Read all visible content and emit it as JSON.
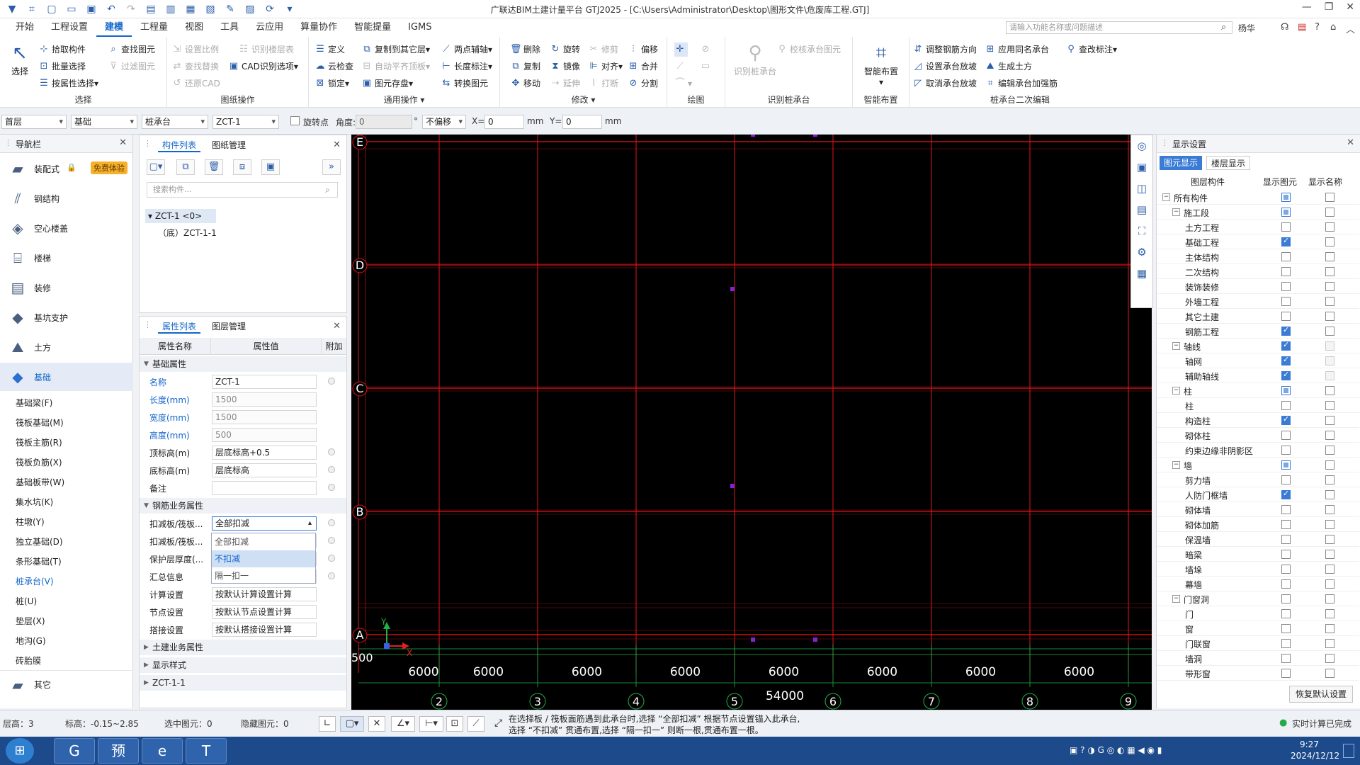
{
  "window": {
    "title": "广联达BIM土建计量平台 GTJ2025 - [C:\\Users\\Administrator\\Desktop\\图形文件\\危废库工程.GTJ]"
  },
  "menu": {
    "items": [
      "开始",
      "工程设置",
      "建模",
      "工程量",
      "视图",
      "工具",
      "云应用",
      "算量协作",
      "智能提量",
      "IGMS"
    ],
    "search_placeholder": "请输入功能名称或问题描述",
    "user": "杨华"
  },
  "ribbon": {
    "select": {
      "label": "选择",
      "pick": "拾取构件",
      "batch": "批量选择",
      "by_prop": "按属性选择",
      "find": "查找图元",
      "filter": "过滤图元"
    },
    "drawing": {
      "label": "图纸操作",
      "set_scale": "设置比例",
      "identify_layer": "识别楼层表",
      "find_replace": "查找替换",
      "cad_options": "CAD识别选项",
      "restore_cad": "还原CAD"
    },
    "general": {
      "label": "通用操作",
      "define": "定义",
      "copy_other": "复制到其它层",
      "two_point": "两点辅轴",
      "cloud_check": "云检查",
      "auto_flat": "自动平齐顶板",
      "length_mark": "长度标注",
      "lock": "锁定",
      "elem_save": "图元存盘",
      "convert": "转换图元"
    },
    "modify": {
      "label": "修改",
      "delete": "删除",
      "rotate": "旋转",
      "trim": "修剪",
      "offset": "偏移",
      "copy": "复制",
      "mirror": "镜像",
      "align": "对齐",
      "merge": "合并",
      "move": "移动",
      "extend": "延伸",
      "break": "打断",
      "split": "分割"
    },
    "draw": {
      "label": "绘图"
    },
    "identify": {
      "label": "识别桩承台",
      "identify_cap": "识别桩承台",
      "check_cap": "校核承台图元"
    },
    "smart": {
      "label": "智能布置",
      "smart_layout": "智能布置"
    },
    "secondary": {
      "label": "桩承台二次编辑",
      "adjust_rebar": "调整钢筋方向",
      "apply_same": "应用同名承台",
      "check_mark": "查改标注",
      "set_slope": "设置承台放坡",
      "gen_earth": "生成土方",
      "cancel_slope": "取消承台放坡",
      "edit_reinf": "编辑承台加强筋"
    }
  },
  "propbar": {
    "floor": "首层",
    "category": "基础",
    "type": "桩承台",
    "name": "ZCT-1",
    "rotate_label": "旋转点",
    "angle_label": "角度:",
    "angle_value": "0",
    "offset": "不偏移",
    "x_label": "X=",
    "x_value": "0",
    "y_label": "Y=",
    "y_value": "0",
    "unit": "mm",
    "deg": "°"
  },
  "nav": {
    "title": "导航栏",
    "badge": "免费体验",
    "categories": [
      "装配式",
      "钢结构",
      "空心楼盖",
      "楼梯",
      "装修",
      "基坑支护",
      "土方",
      "基础",
      "其它"
    ],
    "sub": [
      "基础梁(F)",
      "筏板基础(M)",
      "筏板主筋(R)",
      "筏板负筋(X)",
      "基础板带(W)",
      "集水坑(K)",
      "柱墩(Y)",
      "独立基础(D)",
      "条形基础(T)",
      "桩承台(V)",
      "桩(U)",
      "垫层(X)",
      "地沟(G)",
      "砖胎膜"
    ]
  },
  "complist": {
    "tab1": "构件列表",
    "tab2": "图纸管理",
    "search": "搜索构件...",
    "item": "ZCT-1 <0>",
    "child": "（底）ZCT-1-1"
  },
  "proplist": {
    "tab1": "属性列表",
    "tab2": "图层管理",
    "col1": "属性名称",
    "col2": "属性值",
    "col3": "附加",
    "sec1": "基础属性",
    "rows": [
      {
        "n": "名称",
        "v": "ZCT-1"
      },
      {
        "n": "长度(mm)",
        "v": "1500"
      },
      {
        "n": "宽度(mm)",
        "v": "1500"
      },
      {
        "n": "高度(mm)",
        "v": "500"
      },
      {
        "n": "顶标高(m)",
        "v": "层底标高+0.5"
      },
      {
        "n": "底标高(m)",
        "v": "层底标高"
      },
      {
        "n": "备注",
        "v": ""
      }
    ],
    "sec2": "钢筋业务属性",
    "rows2": [
      {
        "n": "扣减板/筏板...",
        "v": "全部扣减"
      },
      {
        "n": "扣减板/筏板...",
        "v": ""
      },
      {
        "n": "保护层厚度(...",
        "v": ""
      },
      {
        "n": "汇总信息",
        "v": ""
      },
      {
        "n": "计算设置",
        "v": "按默认计算设置计算"
      },
      {
        "n": "节点设置",
        "v": "按默认节点设置计算"
      },
      {
        "n": "搭接设置",
        "v": "按默认搭接设置计算"
      }
    ],
    "sec3": "土建业务属性",
    "sec4": "显示样式",
    "sec5": "ZCT-1-1",
    "dropdown": [
      "全部扣减",
      "不扣减",
      "隔一扣一"
    ]
  },
  "canvas": {
    "row_labels": [
      "E",
      "D",
      "C",
      "B",
      "A"
    ],
    "col_labels": [
      "2",
      "3",
      "4",
      "5",
      "6",
      "7",
      "8",
      "9"
    ],
    "dims": [
      "6000",
      "6000",
      "6000",
      "6000",
      "6000",
      "6000",
      "6000",
      "6000"
    ],
    "total": "54000",
    "left_dim": "500",
    "axis_x": "X",
    "axis_y": "Y"
  },
  "display": {
    "title": "显示设置",
    "tab1": "图元显示",
    "tab2": "楼层显示",
    "col1": "图层构件",
    "col2": "显示图元",
    "col3": "显示名称",
    "rows": [
      {
        "n": "所有构件",
        "lvl": 0,
        "exp": "−",
        "a": "part",
        "b": ""
      },
      {
        "n": "施工段",
        "lvl": 1,
        "exp": "−",
        "a": "part",
        "b": ""
      },
      {
        "n": "土方工程",
        "lvl": 2,
        "a": "",
        "b": ""
      },
      {
        "n": "基础工程",
        "lvl": 2,
        "a": "on",
        "b": ""
      },
      {
        "n": "主体结构",
        "lvl": 2,
        "a": "",
        "b": ""
      },
      {
        "n": "二次结构",
        "lvl": 2,
        "a": "",
        "b": ""
      },
      {
        "n": "装饰装修",
        "lvl": 2,
        "a": "",
        "b": ""
      },
      {
        "n": "外墙工程",
        "lvl": 2,
        "a": "",
        "b": ""
      },
      {
        "n": "其它土建",
        "lvl": 2,
        "a": "",
        "b": ""
      },
      {
        "n": "钢筋工程",
        "lvl": 2,
        "a": "on",
        "b": ""
      },
      {
        "n": "轴线",
        "lvl": 1,
        "exp": "−",
        "a": "on",
        "b": "gray"
      },
      {
        "n": "轴网",
        "lvl": 2,
        "a": "on",
        "b": "gray"
      },
      {
        "n": "辅助轴线",
        "lvl": 2,
        "a": "on",
        "b": "gray"
      },
      {
        "n": "柱",
        "lvl": 1,
        "exp": "−",
        "a": "part",
        "b": ""
      },
      {
        "n": "柱",
        "lvl": 2,
        "a": "",
        "b": ""
      },
      {
        "n": "构造柱",
        "lvl": 2,
        "a": "on",
        "b": ""
      },
      {
        "n": "砌体柱",
        "lvl": 2,
        "a": "",
        "b": ""
      },
      {
        "n": "约束边缘非阴影区",
        "lvl": 2,
        "a": "",
        "b": ""
      },
      {
        "n": "墙",
        "lvl": 1,
        "exp": "−",
        "a": "part",
        "b": ""
      },
      {
        "n": "剪力墙",
        "lvl": 2,
        "a": "",
        "b": ""
      },
      {
        "n": "人防门框墙",
        "lvl": 2,
        "a": "on",
        "b": ""
      },
      {
        "n": "砌体墙",
        "lvl": 2,
        "a": "",
        "b": ""
      },
      {
        "n": "砌体加筋",
        "lvl": 2,
        "a": "",
        "b": ""
      },
      {
        "n": "保温墙",
        "lvl": 2,
        "a": "",
        "b": ""
      },
      {
        "n": "暗梁",
        "lvl": 2,
        "a": "",
        "b": ""
      },
      {
        "n": "墙垛",
        "lvl": 2,
        "a": "",
        "b": ""
      },
      {
        "n": "幕墙",
        "lvl": 2,
        "a": "",
        "b": ""
      },
      {
        "n": "门窗洞",
        "lvl": 1,
        "exp": "−",
        "a": "",
        "b": ""
      },
      {
        "n": "门",
        "lvl": 2,
        "a": "",
        "b": ""
      },
      {
        "n": "窗",
        "lvl": 2,
        "a": "",
        "b": ""
      },
      {
        "n": "门联窗",
        "lvl": 2,
        "a": "",
        "b": ""
      },
      {
        "n": "墙洞",
        "lvl": 2,
        "a": "",
        "b": ""
      },
      {
        "n": "带形窗",
        "lvl": 2,
        "a": "",
        "b": ""
      }
    ],
    "restore": "恢复默认设置"
  },
  "status": {
    "floor_h": "层高：3",
    "elev": "标高：-0.15~2.85",
    "selected": "选中图元：0",
    "hidden": "隐藏图元：0",
    "hint1": "在选择板 / 筏板面筋遇到此承台时,选择 “全部扣减” 根据节点设置锚入此承台,",
    "hint2": "选择 “不扣减” 贯通布置,选择 “隔一扣一” 则断一根,贯通布置一根。",
    "calc": "实时计算已完成"
  },
  "taskbar": {
    "time": "9:27",
    "date": "2024/12/12"
  },
  "colors": {
    "accent": "#1266c9",
    "grid": "#e0161b",
    "axis_green": "#22b04a",
    "marker": "#8a1fd1"
  }
}
